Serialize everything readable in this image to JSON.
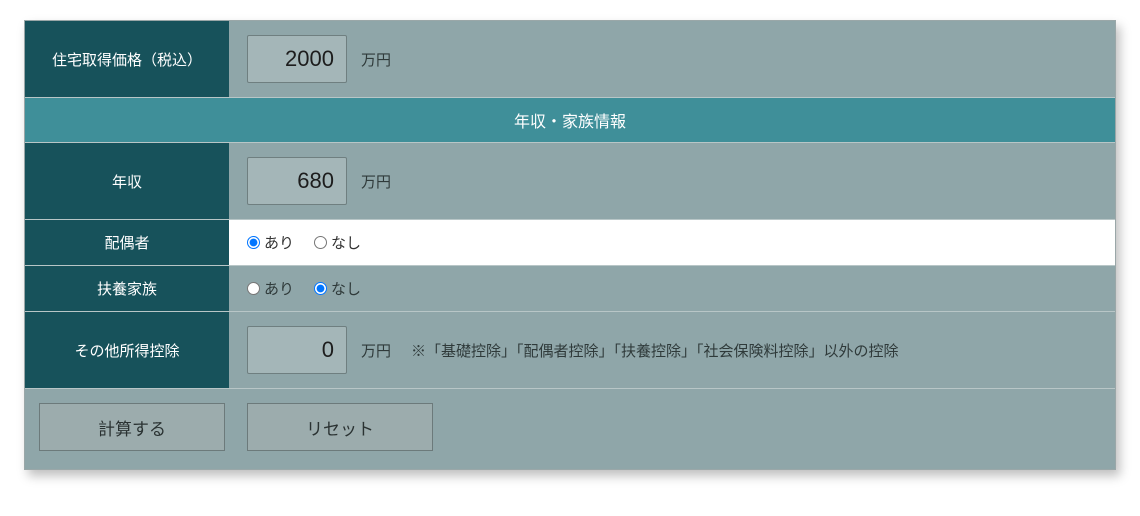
{
  "rows": {
    "price": {
      "label": "住宅取得価格（税込）",
      "value": "2000",
      "unit": "万円"
    },
    "income": {
      "label": "年収",
      "value": "680",
      "unit": "万円"
    },
    "spouse": {
      "label": "配偶者",
      "options": {
        "yes": "あり",
        "no": "なし"
      },
      "selected": "yes"
    },
    "dependents": {
      "label": "扶養家族",
      "options": {
        "yes": "あり",
        "no": "なし"
      },
      "selected": "no"
    },
    "other_deduction": {
      "label": "その他所得控除",
      "value": "0",
      "unit": "万円",
      "note": "※「基礎控除」「配偶者控除」「扶養控除」「社会保険料控除」以外の控除"
    }
  },
  "section_header": "年収・家族情報",
  "buttons": {
    "calc": "計算する",
    "reset": "リセット"
  }
}
